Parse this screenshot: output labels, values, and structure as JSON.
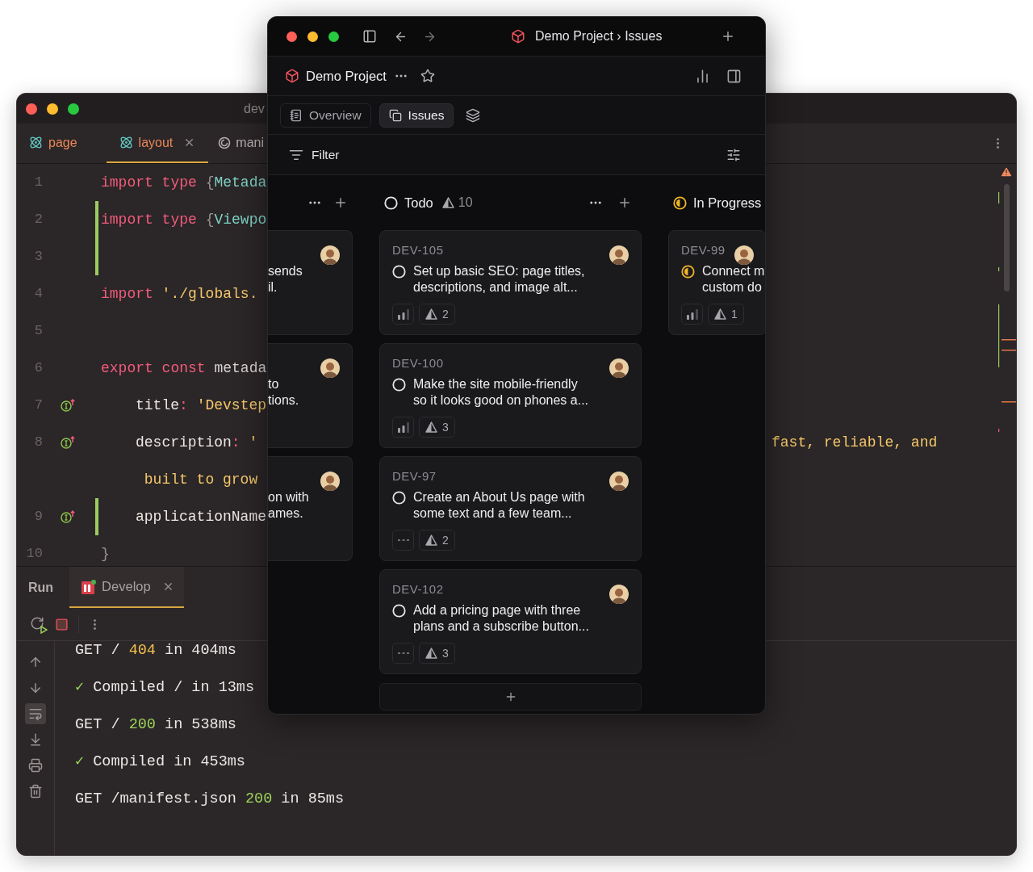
{
  "ide": {
    "title": "dev",
    "tabs": [
      {
        "label": "page",
        "selected": false
      },
      {
        "label": "layout",
        "selected": true
      },
      {
        "label": "mani",
        "selected": false
      }
    ],
    "code_lines": [
      {
        "number": "1",
        "indented": false,
        "changed": false,
        "marker": false,
        "tokens": [
          {
            "text": "import type",
            "kind": "keyword"
          },
          {
            "text": " {",
            "kind": "punct"
          },
          {
            "text": "Metada",
            "kind": "type"
          }
        ]
      },
      {
        "number": "2",
        "indented": false,
        "changed": true,
        "marker": false,
        "tokens": [
          {
            "text": "import type",
            "kind": "keyword"
          },
          {
            "text": " {",
            "kind": "punct"
          },
          {
            "text": "Viewpo",
            "kind": "type"
          }
        ]
      },
      {
        "number": "3",
        "changed": true,
        "marker": false
      },
      {
        "number": "4",
        "indented": false,
        "changed": false,
        "marker": false,
        "tokens": [
          {
            "text": "import",
            "kind": "keyword"
          },
          {
            "text": " './globals.",
            "kind": "string"
          }
        ]
      },
      {
        "number": "5",
        "changed": false,
        "marker": false
      },
      {
        "number": "6",
        "indented": false,
        "changed": false,
        "marker": false,
        "tokens": [
          {
            "text": "export const",
            "kind": "keyword"
          },
          {
            "text": " metada",
            "kind": "plain"
          }
        ]
      },
      {
        "number": "7",
        "indented": true,
        "changed": false,
        "marker": true,
        "tokens": [
          {
            "text": "title",
            "kind": "prop"
          },
          {
            "text": ":",
            "kind": "op"
          },
          {
            "text": " 'Devstep",
            "kind": "string"
          }
        ]
      },
      {
        "number": "8",
        "indented": true,
        "changed": false,
        "marker": true,
        "tokens": [
          {
            "text": "description",
            "kind": "prop"
          },
          {
            "text": ":",
            "kind": "op"
          },
          {
            "text": " '",
            "kind": "string"
          }
        ],
        "right_text": "fast, reliable, and"
      },
      {
        "indented": true,
        "changed": false,
        "marker": false,
        "tokens": [
          {
            "text": " built to grow",
            "kind": "string"
          }
        ]
      },
      {
        "number": "9",
        "indented": true,
        "changed": true,
        "marker": true,
        "tokens": [
          {
            "text": "applicationName",
            "kind": "prop"
          }
        ]
      },
      {
        "number": "10",
        "changed": false,
        "marker": false,
        "tokens": [
          {
            "text": "}",
            "kind": "punct"
          }
        ]
      }
    ],
    "run_panel": {
      "label": "Run",
      "tabs": [
        {
          "label": "Develop",
          "selected": true
        }
      ],
      "tools": [
        {
          "kind": "up",
          "on": false
        },
        {
          "kind": "down",
          "on": false
        },
        {
          "kind": "wrap",
          "on": true
        },
        {
          "kind": "scroll_end",
          "on": false
        },
        {
          "kind": "print",
          "on": false
        },
        {
          "kind": "trash",
          "on": false
        }
      ],
      "log": [
        {
          "tokens": [
            {
              "text": "GET / ",
              "kind": "plain"
            },
            {
              "text": "404",
              "kind": "warn"
            },
            {
              "text": " in 404ms",
              "kind": "plain"
            }
          ]
        },
        {
          "tokens": [
            {
              "text": "✓",
              "kind": "check"
            },
            {
              "text": " Compiled / in 13ms",
              "kind": "plain"
            }
          ]
        },
        {
          "tokens": [
            {
              "text": "GET / ",
              "kind": "plain"
            },
            {
              "text": "200",
              "kind": "ok"
            },
            {
              "text": " in 538ms",
              "kind": "plain"
            }
          ]
        },
        {
          "tokens": [
            {
              "text": "✓",
              "kind": "check"
            },
            {
              "text": " Compiled in 453ms",
              "kind": "plain"
            }
          ]
        },
        {
          "tokens": [
            {
              "text": "GET /manifest.json ",
              "kind": "plain"
            },
            {
              "text": "200",
              "kind": "ok"
            },
            {
              "text": " in 85ms",
              "kind": "plain"
            }
          ]
        }
      ]
    }
  },
  "app": {
    "breadcrumb": "Demo Project › Issues",
    "project": "Demo Project",
    "tabs": [
      {
        "label": "Overview",
        "selected": false
      },
      {
        "label": "Issues",
        "selected": true
      }
    ],
    "filter": "Filter",
    "columns": [
      {
        "kind": "unknown",
        "cards": [
          {
            "title_lines": [
              "sends",
              "il."
            ]
          },
          {
            "title_lines": [
              "to",
              "tions."
            ]
          },
          {
            "title_lines": [
              "on with",
              "ames."
            ]
          }
        ]
      },
      {
        "kind": "todo",
        "name": "Todo",
        "count": "10",
        "cards": [
          {
            "id": "DEV-105",
            "kind": "todo",
            "title_lines": [
              "Set up basic SEO: page titles,",
              "descriptions, and image alt..."
            ],
            "level": 0.67,
            "estimate": "2"
          },
          {
            "id": "DEV-100",
            "kind": "todo",
            "title_lines": [
              "Make the site mobile-friendly",
              "so it looks good on phones a..."
            ],
            "level": 0.67,
            "estimate": "3"
          },
          {
            "id": "DEV-97",
            "kind": "todo",
            "title_lines": [
              "Create an About Us page with",
              "some text and a few team..."
            ],
            "estimate": "2"
          },
          {
            "id": "DEV-102",
            "kind": "todo",
            "title_lines": [
              "Add a pricing page with three",
              "plans and a subscribe button..."
            ],
            "estimate": "3"
          }
        ]
      },
      {
        "kind": "in_progress",
        "name": "In Progress",
        "cards": [
          {
            "id": "DEV-99",
            "kind": "in_progress",
            "title_lines": [
              "Connect m",
              "custom do"
            ],
            "level": 0.67,
            "estimate": "1"
          }
        ]
      }
    ]
  }
}
